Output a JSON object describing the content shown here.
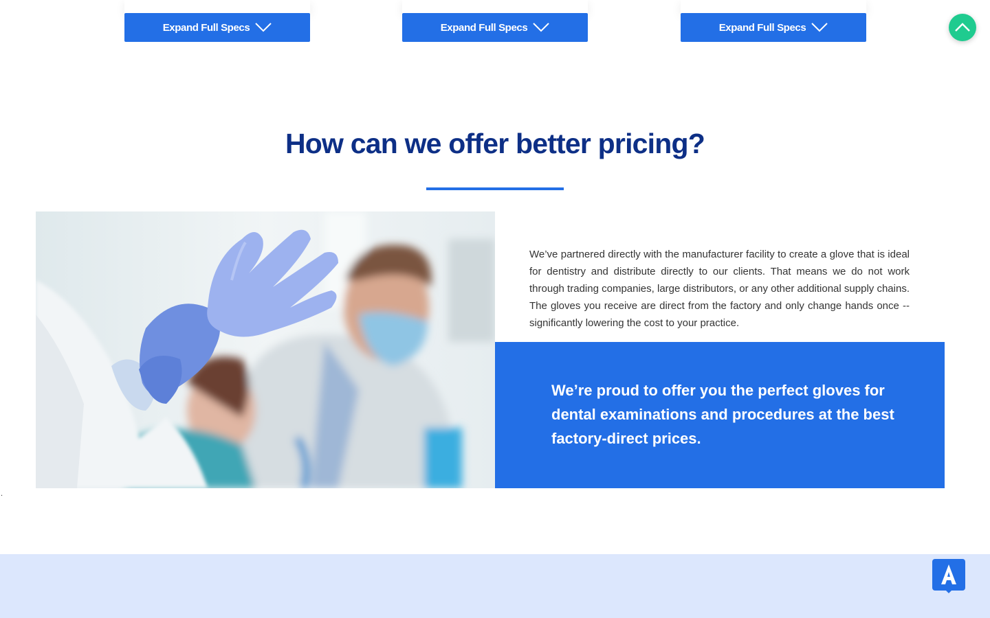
{
  "product_cards": [
    {
      "button_label": "Expand Full Specs",
      "icon": "chevron-down-icon"
    },
    {
      "button_label": "Expand Full Specs",
      "icon": "chevron-down-icon"
    },
    {
      "button_label": "Expand Full Specs",
      "icon": "chevron-down-icon"
    }
  ],
  "scroll_top": {
    "icon": "chevron-up-icon",
    "color": "#1fcb8f"
  },
  "pricing_section": {
    "title": "How can we offer better pricing?",
    "image": "dentist-putting-on-blue-gloves-photo",
    "body": "We’ve partnered directly with the manufacturer facility to create a glove that is ideal for dentistry and distribute directly to our clients. That means we do not work through trading companies, large distributors, or any other additional supply chains. The gloves you receive are direct from the factory and only change hands once -- significantly lowering the cost to your practice.",
    "highlight": "We’re proud to offer you the perfect gloves for dental examinations and procedures at the best factory-direct prices."
  },
  "stray_text": ".",
  "accessibility_widget": {
    "letter": "A",
    "icon": "accessibility-icon"
  },
  "colors": {
    "primary": "#236fe6",
    "title": "#0d2f86",
    "band": "#dce7fd",
    "accent_green": "#1fcb8f"
  }
}
